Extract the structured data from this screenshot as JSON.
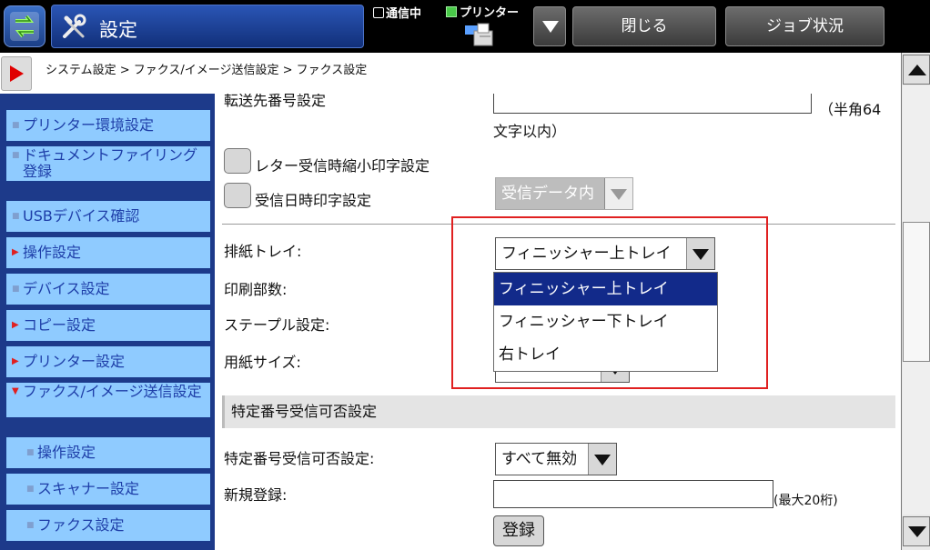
{
  "header": {
    "title": "設定",
    "comm_status": "通信中",
    "printer_status": "プリンター",
    "close_label": "閉じる",
    "job_status_label": "ジョブ状況",
    "icons": {
      "home": "home-switch-icon",
      "tool": "tools-icon",
      "printer": "printer-status-icon",
      "dropdown": "triangle-down-icon"
    }
  },
  "breadcrumb": {
    "text": "システム設定 > ファクス/イメージ送信設定 > ファクス設定",
    "back_icon": "red-play-arrow-icon"
  },
  "sidebar": {
    "items": [
      {
        "label": "プリンター環境設定"
      },
      {
        "label": "ドキュメントファイリング登録"
      },
      {
        "label": "USBデバイス確認"
      },
      {
        "label": "操作設定"
      },
      {
        "label": "デバイス設定"
      },
      {
        "label": "コピー設定"
      },
      {
        "label": "プリンター設定"
      },
      {
        "label": "ファクス/イメージ送信設定"
      },
      {
        "label": "操作設定"
      },
      {
        "label": "スキャナー設定"
      },
      {
        "label": "ファクス設定"
      }
    ]
  },
  "main": {
    "forward_number_label": "転送先番号設定",
    "forward_number_note_1": "（半角64",
    "forward_number_note_2": "文字以内）",
    "letter_reduce_label": "レター受信時縮小印字設定",
    "recv_datetime_label": "受信日時印字設定",
    "recv_datetime_select": "受信データ内",
    "output_tray_label": "排紙トレイ:",
    "output_tray_value": "フィニッシャー上トレイ",
    "output_tray_options": [
      "フィニッシャー上トレイ",
      "フィニッシャー下トレイ",
      "右トレイ"
    ],
    "copies_label": "印刷部数:",
    "staple_label": "ステープル設定:",
    "paper_size_label": "用紙サイズ:",
    "section_title": "特定番号受信可否設定",
    "specific_label": "特定番号受信可否設定:",
    "specific_value": "すべて無効",
    "new_reg_label": "新規登録:",
    "new_reg_note": "(最大20桁)",
    "register_button": "登録"
  },
  "colors": {
    "accent": "#1c3f86",
    "nav_bg": "#8fcbff",
    "highlight": "#e02020",
    "selected_option": "#122a8a"
  }
}
